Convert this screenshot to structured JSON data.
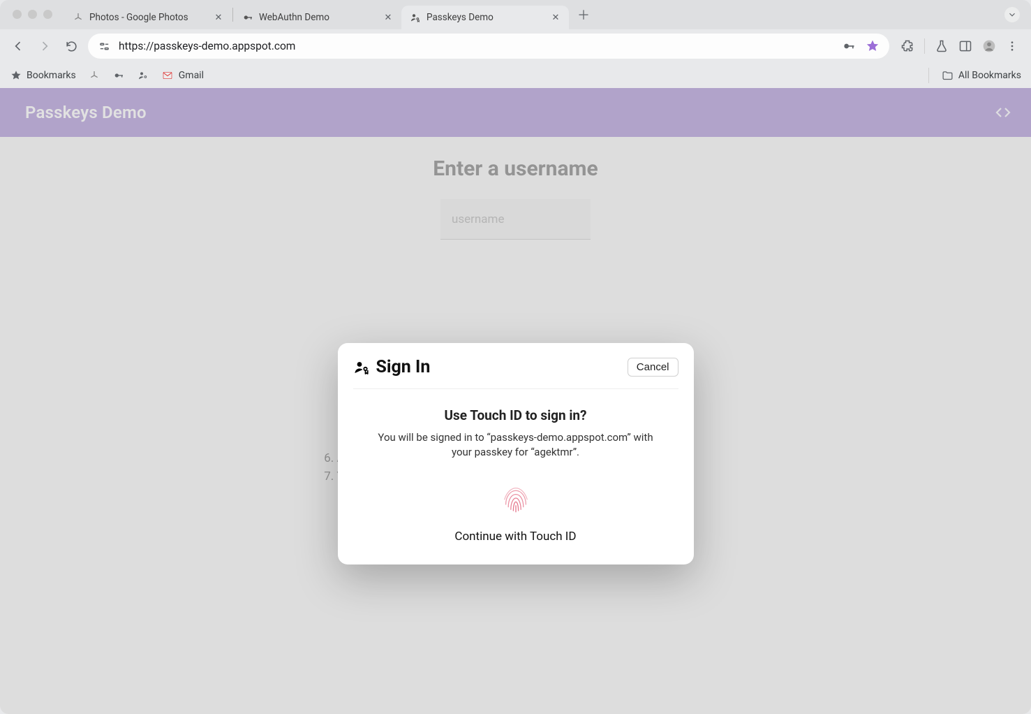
{
  "browser": {
    "tabs": [
      {
        "title": "Photos - Google Photos"
      },
      {
        "title": "WebAuthn Demo"
      },
      {
        "title": "Passkeys Demo"
      }
    ],
    "url": "https://passkeys-demo.appspot.com",
    "bookmarks_label": "Bookmarks",
    "gmail_label": "Gmail",
    "all_bookmarks_label": "All Bookmarks"
  },
  "app": {
    "title": "Passkeys Demo",
    "heading": "Enter a username",
    "username_placeholder": "username",
    "steps": {
      "s6": "Authenticate.",
      "s7": "You are signed in."
    }
  },
  "modal": {
    "title": "Sign In",
    "cancel": "Cancel",
    "question": "Use Touch ID to sign in?",
    "subtitle": "You will be signed in to “passkeys-demo.appspot.com” with your passkey for “agektmr”.",
    "continue": "Continue with Touch ID"
  }
}
